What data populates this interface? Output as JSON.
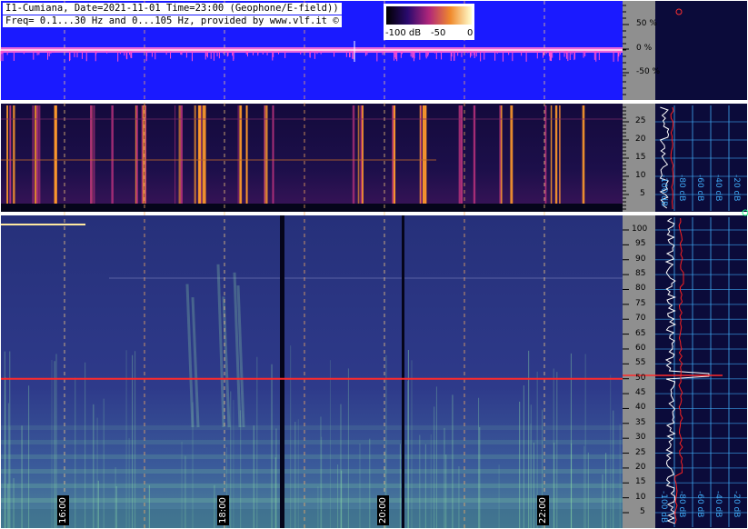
{
  "header": {
    "line1": "I1-Cumiana, Date=2021-11-01 Time=23:00 (Geophone/E-field))",
    "line2": "Freq= 0.1...30 Hz and 0...105 Hz, provided by www.vlf.it ©"
  },
  "colorbar": {
    "labels": [
      "-100 dB",
      "-50",
      "0"
    ]
  },
  "colors": {
    "panel_bg": "#1a1aff",
    "signal": "#ff3cc8",
    "spectrogram_dark": "#0a0a30",
    "hum_line": "#ff3030",
    "db_grid": "#3fa9f5",
    "side_bg": "#0b0b3a"
  },
  "time_labels": [
    "16:00",
    "18:00",
    "20:00",
    "22:00"
  ],
  "chart_data": [
    {
      "type": "line",
      "panel": "amplitude",
      "ylabel_ticks": [
        "50 %",
        "0 %",
        "-50 %"
      ],
      "ylim": [
        -100,
        100
      ]
    },
    {
      "type": "heatmap",
      "panel": "low-frequency spectrogram",
      "ytick_labels": [
        "5",
        "10",
        "15",
        "20",
        "25"
      ],
      "ylim": [
        0.1,
        30
      ],
      "x": [
        "16:00",
        "18:00",
        "20:00",
        "22:00"
      ]
    },
    {
      "type": "heatmap",
      "panel": "high-frequency spectrogram",
      "ytick_labels": [
        "5",
        "10",
        "15",
        "20",
        "25",
        "30",
        "35",
        "40",
        "45",
        "50",
        "55",
        "60",
        "65",
        "70",
        "75",
        "80",
        "85",
        "90",
        "95",
        "100"
      ],
      "ylim": [
        0,
        105
      ],
      "hum_frequency": 50,
      "x": [
        "16:00",
        "18:00",
        "20:00",
        "22:00"
      ]
    },
    {
      "type": "line",
      "panel": "spectrum profile (low)",
      "db_labels": [
        "-100 dB",
        "-80 dB",
        "-60 dB",
        "-40 dB",
        "-20 dB"
      ]
    },
    {
      "type": "line",
      "panel": "spectrum profile (high)",
      "db_labels": [
        "-100 dB",
        "-80 dB",
        "-60 dB",
        "-40 dB",
        "-20 dB"
      ]
    }
  ]
}
